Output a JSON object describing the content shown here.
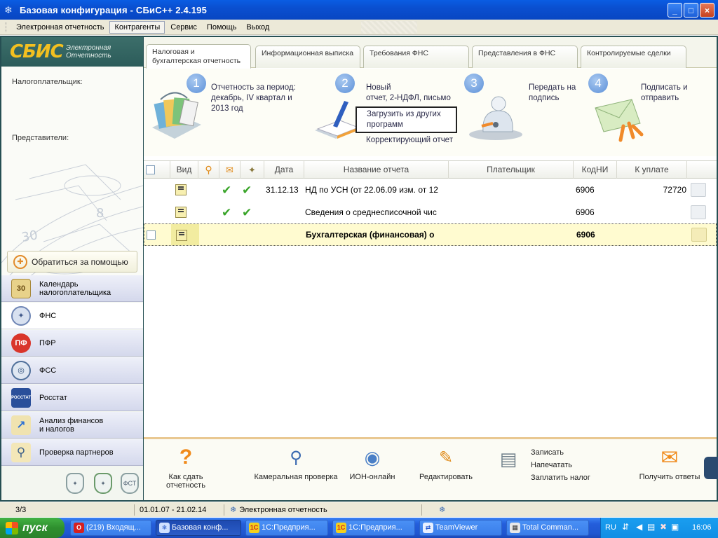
{
  "window": {
    "title": "Базовая конфигурация - СБиС++ 2.4.195",
    "buttons": [
      "_",
      "□",
      "×"
    ]
  },
  "menu": [
    "Электронная отчетность",
    "Контрагенты",
    "Сервис",
    "Помощь",
    "Выход"
  ],
  "logo": {
    "brand": "СБИС",
    "subtitle_1": "Электронная",
    "subtitle_2": "Отчетность"
  },
  "left": {
    "taxpayer_label": "Налогоплательщик:",
    "reps_label": "Представители:",
    "help_button": "Обратиться за помощью",
    "nav": [
      {
        "label_1": "Календарь",
        "label_2": "налогоплательщика",
        "icon": "calendar-icon",
        "badge": "30"
      },
      {
        "label_1": "ФНС",
        "label_2": "",
        "icon": "fns-emblem-icon"
      },
      {
        "label_1": "ПФР",
        "label_2": "",
        "icon": "pfr-icon"
      },
      {
        "label_1": "ФСС",
        "label_2": "",
        "icon": "fss-icon"
      },
      {
        "label_1": "Росстат",
        "label_2": "",
        "icon": "rosstat-icon",
        "badge": "РОССТАТ"
      },
      {
        "label_1": "Анализ финансов",
        "label_2": "и налогов",
        "icon": "chart-icon"
      },
      {
        "label_1": "Проверка партнеров",
        "label_2": "",
        "icon": "magnifier-icon"
      }
    ]
  },
  "tabs": [
    {
      "line1": "Налоговая и",
      "line2": "бухгалтерская отчетность"
    },
    {
      "line1": "Информационная выписка",
      "line2": ""
    },
    {
      "line1": "Требования ФНС",
      "line2": ""
    },
    {
      "line1": "Представления в ФНС",
      "line2": ""
    },
    {
      "line1": "Контролируемые сделки",
      "line2": ""
    }
  ],
  "steps": [
    {
      "num": "1",
      "l1": "Отчетность за период:",
      "l2": "декабрь, IV квартал и",
      "l3": "2013 год"
    },
    {
      "num": "2",
      "l1": "Новый",
      "l2": "отчет, 2-НДФЛ, письмо",
      "load1": "Загрузить из других",
      "load2": "программ",
      "l4": "Корректирующий отчет"
    },
    {
      "num": "3",
      "l1": "Передать на",
      "l2": "подпись"
    },
    {
      "num": "4",
      "l1": "Подписать и",
      "l2": "отправить"
    }
  ],
  "table": {
    "headers": [
      "Вид",
      "Дата",
      "Название отчета",
      "Плательщик",
      "КодНИ",
      "К уплате"
    ],
    "rows": [
      {
        "date": "31.12.13",
        "name": "НД по УСН (от 22.06.09 изм. от 12",
        "kodni": "6906",
        "amount": "72720",
        "checks": true
      },
      {
        "date": "",
        "name": "Сведения о среднесписочной чис",
        "kodni": "6906",
        "amount": "",
        "checks": true
      },
      {
        "date": "",
        "name": "Бухгалтерская (финансовая) о",
        "kodni": "6906",
        "amount": "",
        "checks": false
      }
    ]
  },
  "toolbar": {
    "how_to_1": "Как сдать",
    "how_to_2": "отчетность",
    "cameral": "Камеральная проверка",
    "ion": "ИОН-онлайн",
    "edit": "Редактировать",
    "write": "Записать",
    "print": "Напечатать",
    "pay": "Заплатить налог",
    "get_answers": "Получить ответы"
  },
  "status": {
    "count": "3/3",
    "period": "01.01.07 - 21.02.14",
    "module": "Электронная отчетность"
  },
  "taskbar": {
    "start": "пуск",
    "tasks": [
      "(219) Входящ...",
      "Базовая конф...",
      "1С:Предприя...",
      "1С:Предприя...",
      "TeamViewer",
      "Total Comman..."
    ],
    "lang": "RU",
    "time": "16:06"
  }
}
